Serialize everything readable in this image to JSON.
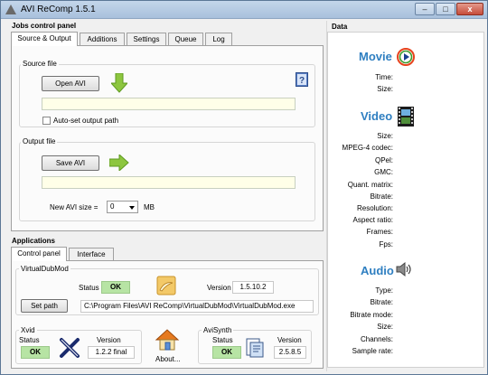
{
  "window": {
    "title": "AVI ReComp  1.5.1",
    "min": "–",
    "max": "□",
    "close": "x"
  },
  "jobs": {
    "heading": "Jobs control panel",
    "tabs": [
      "Source & Output",
      "Additions",
      "Settings",
      "Queue",
      "Log"
    ],
    "source": {
      "group": "Source file",
      "open_btn": "Open AVI",
      "path": "",
      "autoset_label": "Auto-set output path",
      "autoset_checked": false
    },
    "output": {
      "group": "Output file",
      "save_btn": "Save AVI",
      "path": "",
      "size_label": "New AVI size =",
      "size_value": "0",
      "size_unit": "MB"
    }
  },
  "applications": {
    "heading": "Applications",
    "tabs": [
      "Control panel",
      "Interface"
    ],
    "virtualdub": {
      "group": "VirtualDubMod",
      "status_label": "Status",
      "status": "OK",
      "version_label": "Version",
      "version": "1.5.10.2",
      "setpath_btn": "Set path",
      "path": "C:\\Program Files\\AVI ReComp\\VirtualDubMod\\VirtualDubMod.exe"
    },
    "xvid": {
      "group": "Xvid",
      "status_label": "Status",
      "status": "OK",
      "version_label": "Version",
      "version": "1.2.2 final"
    },
    "about": {
      "label": "About..."
    },
    "avisynth": {
      "group": "AviSynth",
      "status_label": "Status",
      "status": "OK",
      "version_label": "Version",
      "version": "2.5.8.5"
    }
  },
  "data": {
    "heading": "Data",
    "movie": {
      "title": "Movie",
      "fields": [
        "Time:",
        "Size:"
      ]
    },
    "video": {
      "title": "Video",
      "fields": [
        "Size:",
        "MPEG-4 codec:",
        "QPel:",
        "GMC:",
        "Quant. matrix:",
        "Bitrate:",
        "Resolution:",
        "Aspect ratio:",
        "Frames:",
        "Fps:"
      ]
    },
    "audio": {
      "title": "Audio",
      "fields": [
        "Type:",
        "Bitrate:",
        "Bitrate mode:",
        "Size:",
        "Channels:",
        "Sample rate:"
      ]
    }
  },
  "colors": {
    "accent": "#2f7fc1",
    "ok": "#b7e4a4",
    "field_bg": "#ffffe8",
    "arrow": "#8dc63f"
  }
}
